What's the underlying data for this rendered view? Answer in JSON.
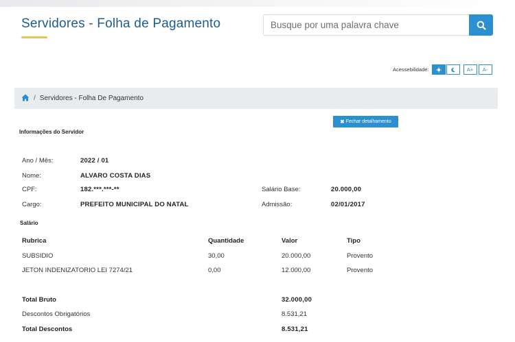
{
  "header": {
    "title": "Servidores - Folha de Pagamento",
    "search_placeholder": "Busque por uma palavra chave"
  },
  "accessibility": {
    "label": "Acessebilidade:",
    "increase_font": "A+",
    "decrease_font": "A-"
  },
  "breadcrumb": {
    "separator": "/",
    "current": "Servidores - Folha De Pagamento"
  },
  "actions": {
    "close_detail_label": "Fechar detalhamento"
  },
  "server_info": {
    "section_title": "Informações do Servidor",
    "ano_mes_label": "Ano / Mês:",
    "ano_mes": "2022 / 01",
    "nome_label": "Nome:",
    "nome": "ALVARO COSTA DIAS",
    "cpf_label": "CPF:",
    "cpf": "182.***.***-**",
    "salario_base_label": "Salário Base:",
    "salario_base": "20.000,00",
    "cargo_label": "Cargo:",
    "cargo": "PREFEITO MUNICIPAL DO NATAL",
    "admissao_label": "Admissão:",
    "admissao": "02/01/2017"
  },
  "salary": {
    "section_title": "Salário",
    "columns": [
      "Rubrica",
      "Quantidade",
      "Valor",
      "Tipo"
    ],
    "rows": [
      {
        "rubrica": "SUBSIDIO",
        "quantidade": "30,00",
        "valor": "20.000,00",
        "tipo": "Provento"
      },
      {
        "rubrica": "JETON INDENIZATORIO LEI 7274/21",
        "quantidade": "0,00",
        "valor": "12.000,00",
        "tipo": "Provento"
      }
    ],
    "total_bruto_label": "Total Bruto",
    "total_bruto": "32.000,00",
    "descontos_obrigatorios_label": "Descontos Obrigatórios",
    "descontos_obrigatorios": "8.531,21",
    "total_descontos_label": "Total Descontos",
    "total_descontos": "8.531,21"
  },
  "colors": {
    "brand_blue": "#2b8fd0",
    "title_blue": "#1d5c8f",
    "accent_yellow": "#e6c84a",
    "breadcrumb_bg": "#e9ecef"
  },
  "icons": [
    "search-icon",
    "contrast-icon",
    "moon-icon",
    "home-icon",
    "close-icon"
  ]
}
